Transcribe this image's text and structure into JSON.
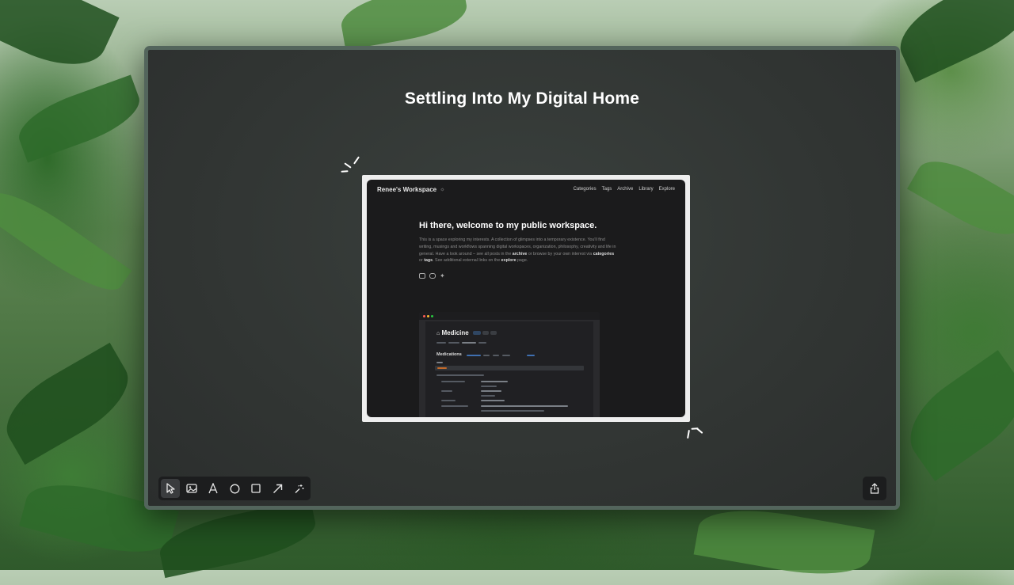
{
  "slide": {
    "title": "Settling Into My Digital Home"
  },
  "screenshot": {
    "brand": "Renee's Workspace",
    "nav": [
      "Categories",
      "Tags",
      "Archive",
      "Library",
      "Explore"
    ],
    "heading": "Hi there, welcome to my public workspace.",
    "paragraph": {
      "p1": "This is a space exploring my interests. A collection of glimpses into a temporary existence. You'll find writing, musings and workflows spanning digital workspaces, organization, philosophy, creativity and life in general. Have a look around – see all posts in the ",
      "archive": "archive",
      "p2": " or browse by your own interest via ",
      "categories": "categories",
      "p3": " or ",
      "tags": "tags",
      "p4": ". See additional external links on the ",
      "explore": "explore",
      "p5": " page."
    },
    "social_icons": [
      "mail-icon",
      "youtube-icon",
      "twitter-icon"
    ],
    "inner_app": {
      "page_title": "Medicine",
      "section_title": "Medications"
    }
  },
  "toolbar": {
    "tools": [
      "pointer-icon",
      "image-icon",
      "text-icon",
      "circle-icon",
      "square-icon",
      "arrow-icon",
      "magic-icon"
    ],
    "active_tool": "pointer-icon",
    "share": "share-icon"
  },
  "colors": {
    "window_border": "#53655c",
    "window_bg": "#313533",
    "toolbar_bg": "#1c1d1e",
    "text": "#ffffff"
  }
}
